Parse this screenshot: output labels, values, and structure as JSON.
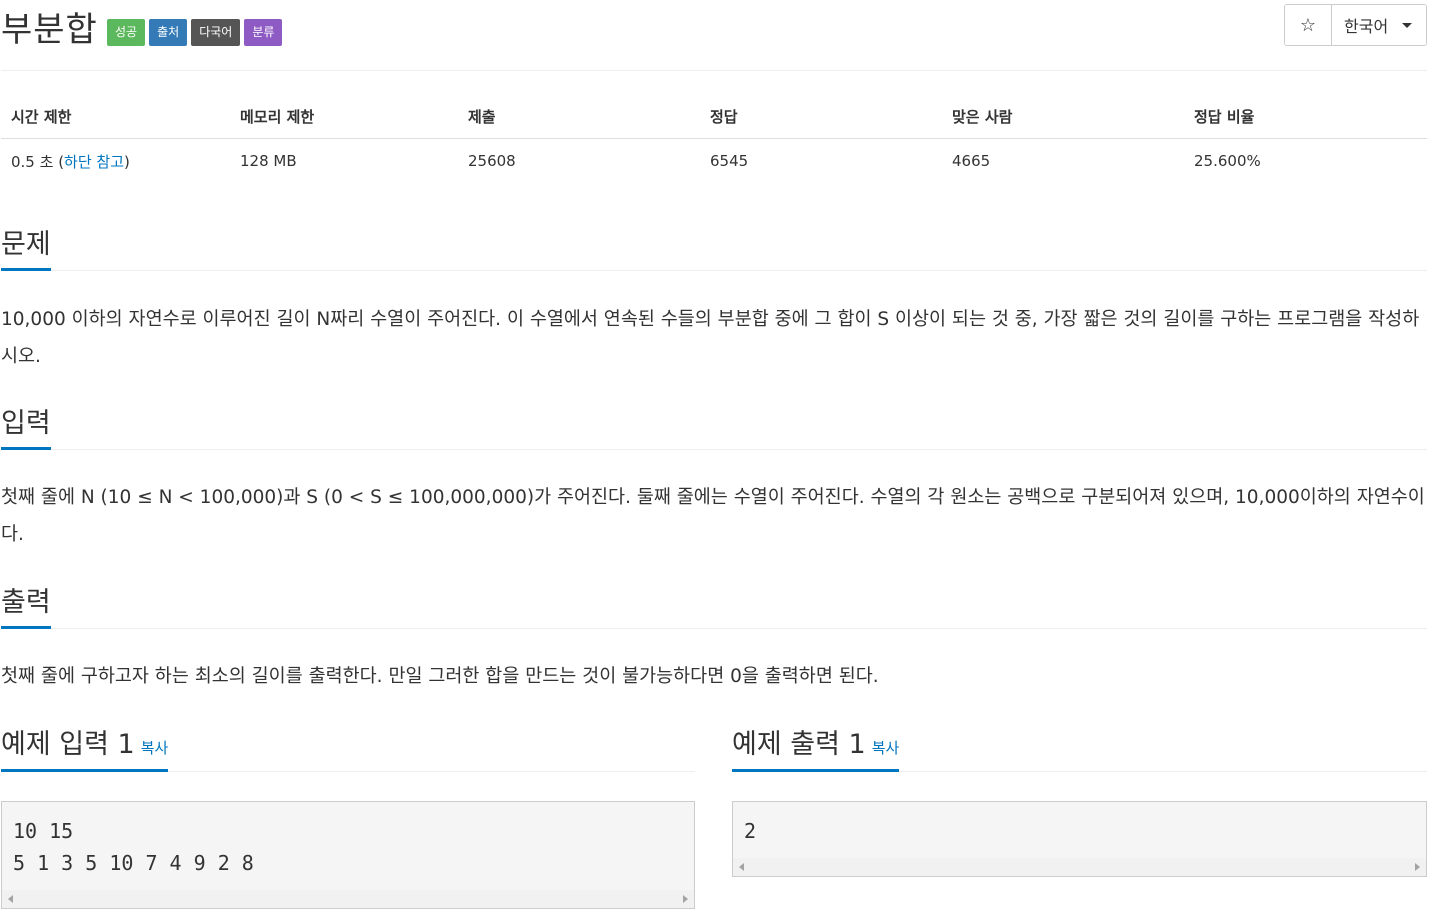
{
  "problem": {
    "title": "부분합",
    "labels": [
      {
        "text": "성공",
        "color": "#5cb85c"
      },
      {
        "text": "출처",
        "color": "#337ab7"
      },
      {
        "text": "다국어",
        "color": "#555555"
      },
      {
        "text": "분류",
        "color": "#8e5bc4"
      }
    ],
    "star_icon": "☆",
    "language": "한국어"
  },
  "info": {
    "headers": [
      "시간 제한",
      "메모리 제한",
      "제출",
      "정답",
      "맞은 사람",
      "정답 비율"
    ],
    "time_limit_prefix": "0.5 초 (",
    "time_limit_link": "하단 참고",
    "time_limit_suffix": ")",
    "memory_limit": "128 MB",
    "submissions": "25608",
    "accepted": "6545",
    "solvers": "4665",
    "ratio": "25.600%"
  },
  "sections": {
    "problem_title": "문제",
    "problem_text": "10,000 이하의 자연수로 이루어진 길이 N짜리 수열이 주어진다. 이 수열에서 연속된 수들의 부분합 중에 그 합이 S 이상이 되는 것 중, 가장 짧은 것의 길이를 구하는 프로그램을 작성하시오.",
    "input_title": "입력",
    "input_text": "첫째 줄에 N (10 ≤ N < 100,000)과 S (0 < S ≤ 100,000,000)가 주어진다. 둘째 줄에는 수열이 주어진다. 수열의 각 원소는 공백으로 구분되어져 있으며, 10,000이하의 자연수이다.",
    "output_title": "출력",
    "output_text": "첫째 줄에 구하고자 하는 최소의 길이를 출력한다. 만일 그러한 합을 만드는 것이 불가능하다면 0을 출력하면 된다."
  },
  "samples": {
    "input_title": "예제 입력 1",
    "output_title": "예제 출력 1",
    "copy_label": "복사",
    "input_lines": "10 15\n5 1 3 5 10 7 4 9 2 8",
    "output_lines": "2"
  }
}
